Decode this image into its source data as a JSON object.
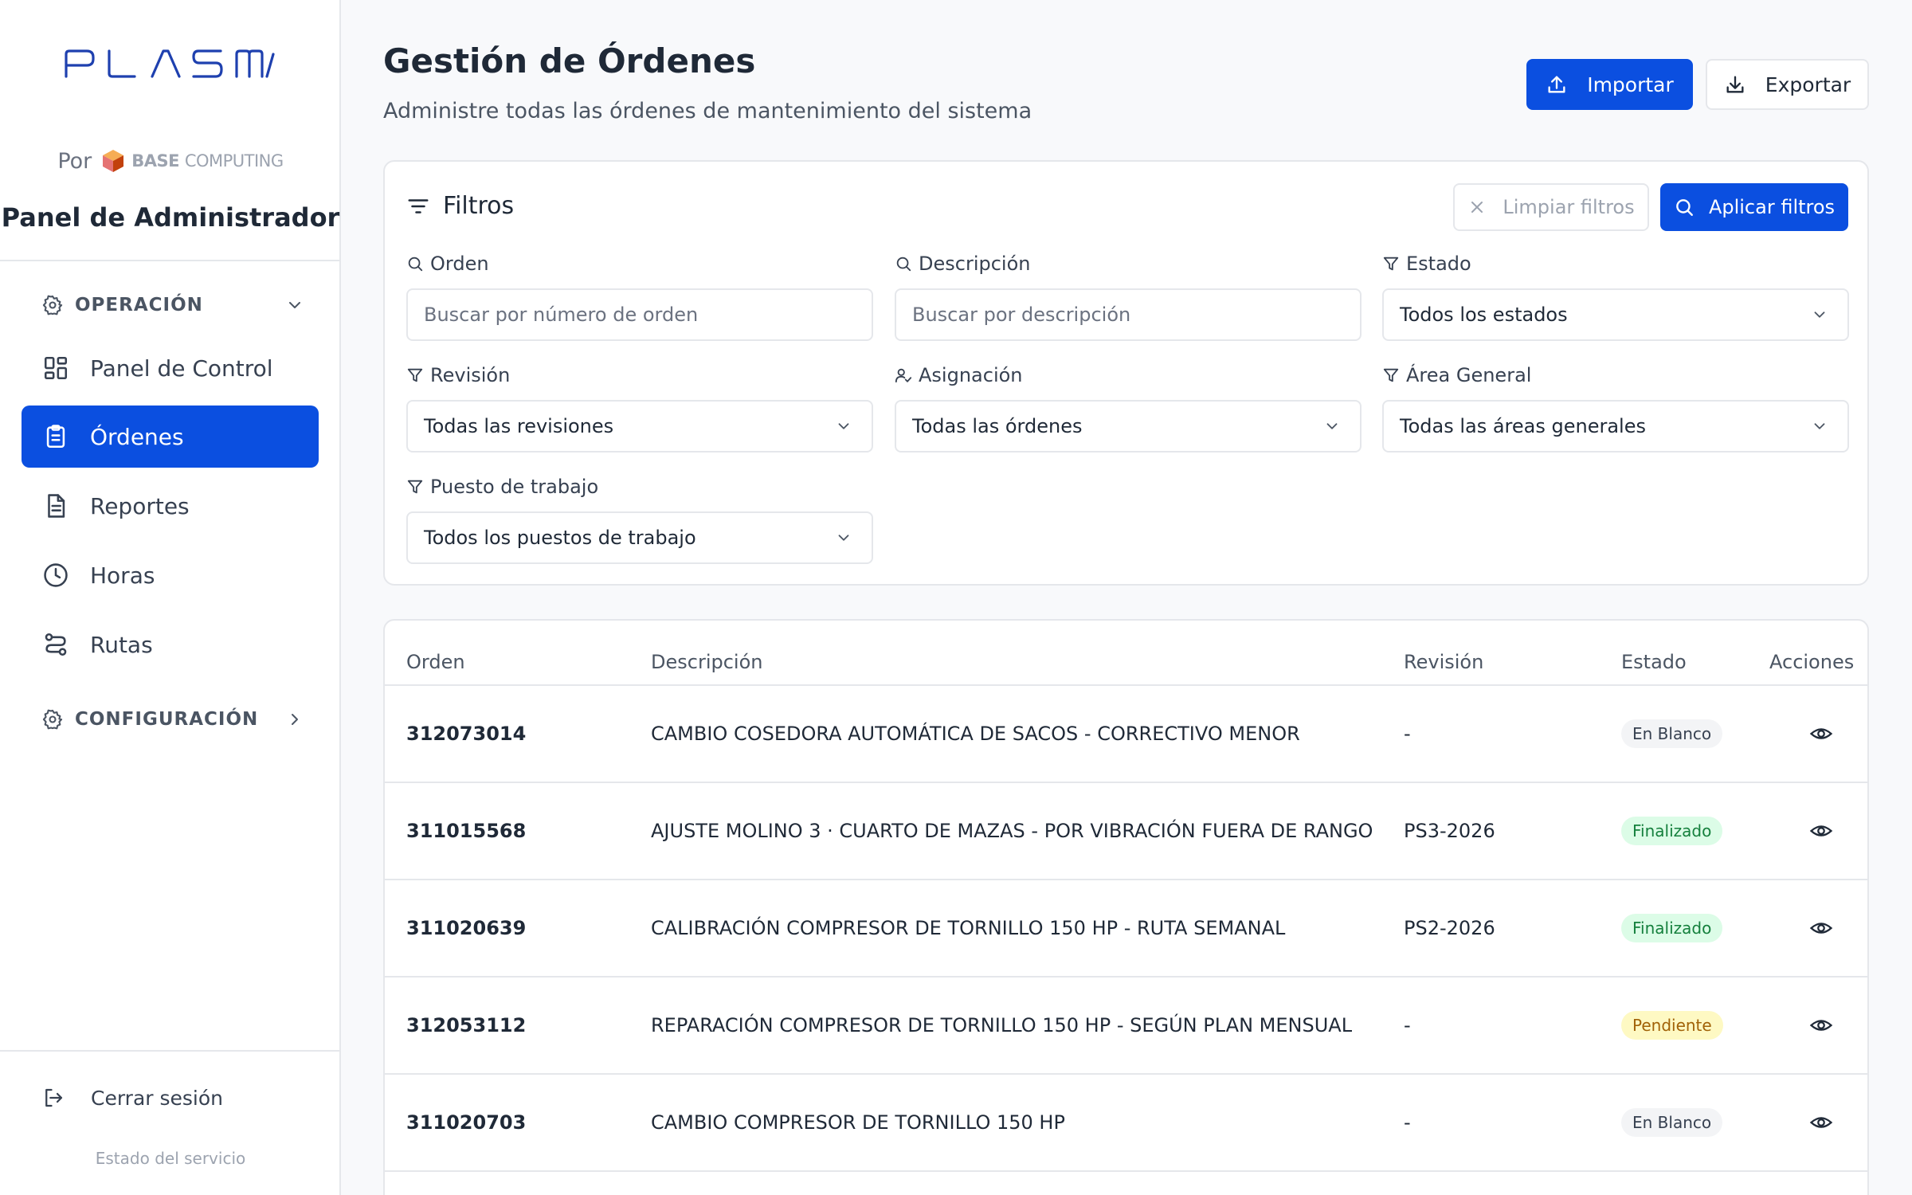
{
  "brand": {
    "logo_text": "PLASMA",
    "by_label": "Por",
    "partner_bold": "BASE",
    "partner_rest": "COMPUTING",
    "panel_title": "Panel de Administrador",
    "accent": "#0b4fe0",
    "logo_color": "#1e40af"
  },
  "sidebar": {
    "section_operation": "OPERACIÓN",
    "items": [
      {
        "label": "Panel de Control",
        "icon": "dashboard-icon",
        "active": false
      },
      {
        "label": "Órdenes",
        "icon": "clipboard-icon",
        "active": true
      },
      {
        "label": "Reportes",
        "icon": "report-icon",
        "active": false
      },
      {
        "label": "Horas",
        "icon": "clock-icon",
        "active": false
      },
      {
        "label": "Rutas",
        "icon": "route-icon",
        "active": false
      }
    ],
    "section_config": "CONFIGURACIÓN",
    "logout": "Cerrar sesión",
    "service_status": "Estado del servicio"
  },
  "header": {
    "title": "Gestión de Órdenes",
    "subtitle": "Administre todas las órdenes de mantenimiento del sistema",
    "import_label": "Importar",
    "export_label": "Exportar"
  },
  "filters": {
    "title": "Filtros",
    "clear_label": "Limpiar filtros",
    "apply_label": "Aplicar filtros",
    "order": {
      "label": "Orden",
      "placeholder": "Buscar por número de orden",
      "value": ""
    },
    "description": {
      "label": "Descripción",
      "placeholder": "Buscar por descripción",
      "value": ""
    },
    "status": {
      "label": "Estado",
      "value": "Todos los estados"
    },
    "revision": {
      "label": "Revisión",
      "value": "Todas las revisiones"
    },
    "assignment": {
      "label": "Asignación",
      "value": "Todas las órdenes"
    },
    "area": {
      "label": "Área General",
      "value": "Todas las áreas generales"
    },
    "workstation": {
      "label": "Puesto de trabajo",
      "value": "Todos los puestos de trabajo"
    }
  },
  "table": {
    "columns": [
      "Orden",
      "Descripción",
      "Revisión",
      "Estado",
      "Acciones"
    ],
    "rows": [
      {
        "order": "312073014",
        "description": "CAMBIO COSEDORA AUTOMÁTICA DE SACOS - CORRECTIVO MENOR",
        "revision": "-",
        "status": "En Blanco",
        "status_kind": "blank"
      },
      {
        "order": "311015568",
        "description": "AJUSTE MOLINO 3 · CUARTO DE MAZAS - POR VIBRACIÓN FUERA DE RANGO",
        "revision": "PS3-2026",
        "status": "Finalizado",
        "status_kind": "done"
      },
      {
        "order": "311020639",
        "description": "CALIBRACIÓN COMPRESOR DE TORNILLO 150 HP - RUTA SEMANAL",
        "revision": "PS2-2026",
        "status": "Finalizado",
        "status_kind": "done"
      },
      {
        "order": "312053112",
        "description": "REPARACIÓN COMPRESOR DE TORNILLO 150 HP - SEGÚN PLAN MENSUAL",
        "revision": "-",
        "status": "Pendiente",
        "status_kind": "pending"
      },
      {
        "order": "311020703",
        "description": "CAMBIO COMPRESOR DE TORNILLO 150 HP",
        "revision": "-",
        "status": "En Blanco",
        "status_kind": "blank"
      }
    ]
  }
}
